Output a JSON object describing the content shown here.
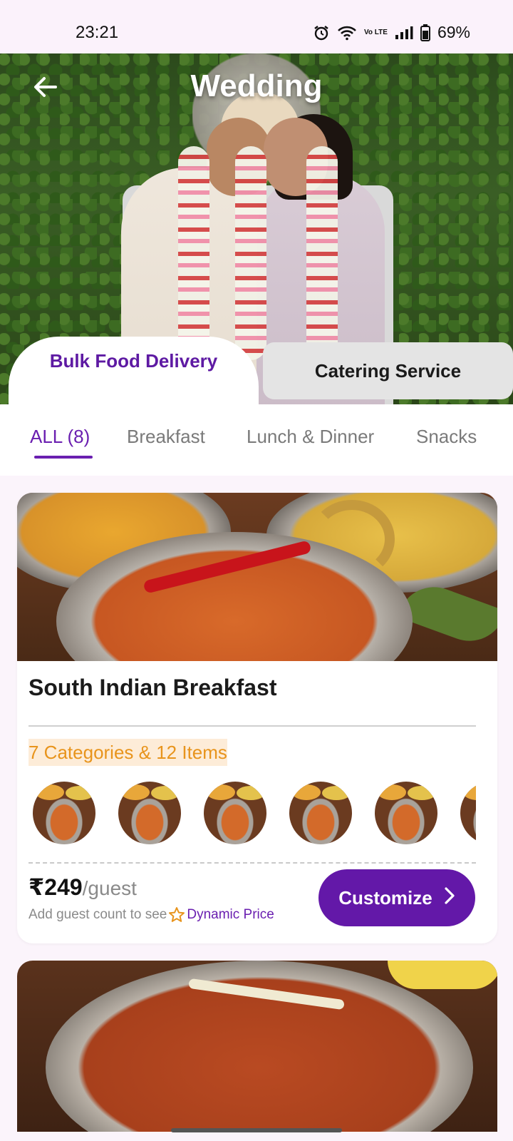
{
  "status_bar": {
    "time": "23:21",
    "battery": "69%",
    "volte_label": "Vo LTE",
    "icons": [
      "alarm-icon",
      "wifi-icon",
      "volte-icon",
      "signal-icon",
      "battery-icon"
    ]
  },
  "header": {
    "title": "Wedding",
    "back_icon": "back-arrow-icon"
  },
  "service_tabs": [
    {
      "label": "Bulk Food Delivery",
      "active": true
    },
    {
      "label": "Catering Service",
      "active": false
    }
  ],
  "category_tabs": [
    {
      "label": "ALL (8)",
      "active": true
    },
    {
      "label": "Breakfast",
      "active": false
    },
    {
      "label": "Lunch & Dinner",
      "active": false
    },
    {
      "label": "Snacks",
      "active": false
    }
  ],
  "packages": [
    {
      "title": "South Indian Breakfast",
      "summary": "7 Categories & 12 Items",
      "price": "₹249",
      "price_unit": "/guest",
      "price_hint": "Add guest count to see",
      "dynamic_label": "Dynamic Price",
      "cta": "Customize"
    }
  ],
  "colors": {
    "brand": "#6318a8",
    "accent_orange": "#e8941c",
    "inactive_tab_bg": "#e4e4e4"
  }
}
